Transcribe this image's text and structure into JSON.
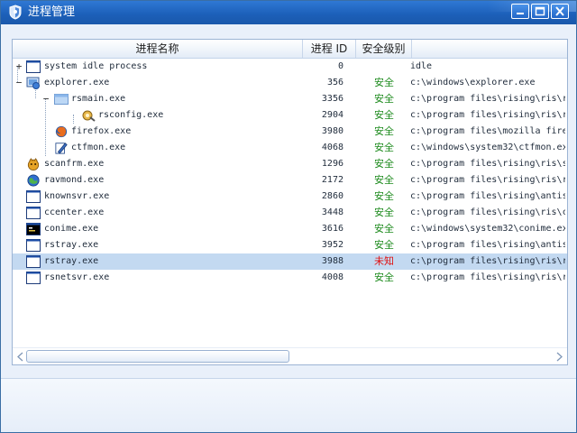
{
  "window": {
    "title": "进程管理",
    "title_icon": "shield-icon",
    "controls": {
      "minimize_icon": "minimize-icon",
      "maximize_icon": "maximize-icon",
      "close_icon": "close-icon"
    }
  },
  "table": {
    "columns": [
      "进程名称",
      "进程 ID",
      "安全级别",
      ""
    ],
    "rows": [
      {
        "expander": "+",
        "icon": "window-icon",
        "name": "system idle process",
        "pid": "0",
        "safety": "",
        "path": "idle"
      },
      {
        "expander": "−",
        "icon": "explorer-icon",
        "name": "explorer.exe",
        "pid": "356",
        "safety": "安全",
        "path": "c:\\windows\\explorer.exe"
      },
      {
        "expander": "−",
        "icon": "rsmain-icon",
        "name": "rsmain.exe",
        "pid": "3356",
        "safety": "安全",
        "path": "c:\\program files\\rising\\ris\\r"
      },
      {
        "expander": "",
        "icon": "rsconfig-icon",
        "name": "rsconfig.exe",
        "pid": "2904",
        "safety": "安全",
        "path": "c:\\program files\\rising\\ris\\r"
      },
      {
        "expander": "",
        "icon": "firefox-icon",
        "name": "firefox.exe",
        "pid": "3980",
        "safety": "安全",
        "path": "c:\\program files\\mozilla fire"
      },
      {
        "expander": "",
        "icon": "ctfmon-icon",
        "name": "ctfmon.exe",
        "pid": "4068",
        "safety": "安全",
        "path": "c:\\windows\\system32\\ctfmon.ex"
      },
      {
        "expander": "",
        "icon": "scanfrm-icon",
        "name": "scanfrm.exe",
        "pid": "1296",
        "safety": "安全",
        "path": "c:\\program files\\rising\\ris\\s"
      },
      {
        "expander": "",
        "icon": "ravmond-icon",
        "name": "ravmond.exe",
        "pid": "2172",
        "safety": "安全",
        "path": "c:\\program files\\rising\\ris\\r"
      },
      {
        "expander": "",
        "icon": "window-icon",
        "name": "knownsvr.exe",
        "pid": "2860",
        "safety": "安全",
        "path": "c:\\program files\\rising\\antis"
      },
      {
        "expander": "",
        "icon": "window-icon",
        "name": "ccenter.exe",
        "pid": "3448",
        "safety": "安全",
        "path": "c:\\program files\\rising\\ris\\c"
      },
      {
        "expander": "",
        "icon": "console-icon",
        "name": "conime.exe",
        "pid": "3616",
        "safety": "安全",
        "path": "c:\\windows\\system32\\conime.ex"
      },
      {
        "expander": "",
        "icon": "window-icon",
        "name": "rstray.exe",
        "pid": "3952",
        "safety": "安全",
        "path": "c:\\program files\\rising\\antis"
      },
      {
        "expander": "",
        "icon": "window-icon",
        "name": "rstray.exe",
        "pid": "3988",
        "safety": "未知",
        "path": "c:\\program files\\rising\\ris\\r",
        "selected": true
      },
      {
        "expander": "",
        "icon": "window-icon",
        "name": "rsnetsvr.exe",
        "pid": "4008",
        "safety": "安全",
        "path": "c:\\program files\\rising\\ris\\r"
      }
    ]
  },
  "colors": {
    "safe": "#1c8a1c",
    "unknown": "#e01010",
    "selected_row": "#c3d9f1",
    "titlebar": "#1c5fb8"
  },
  "scrollbar": {
    "left_icon": "arrow-left-icon",
    "right_icon": "arrow-right-icon",
    "thumb_fraction": 0.49
  }
}
